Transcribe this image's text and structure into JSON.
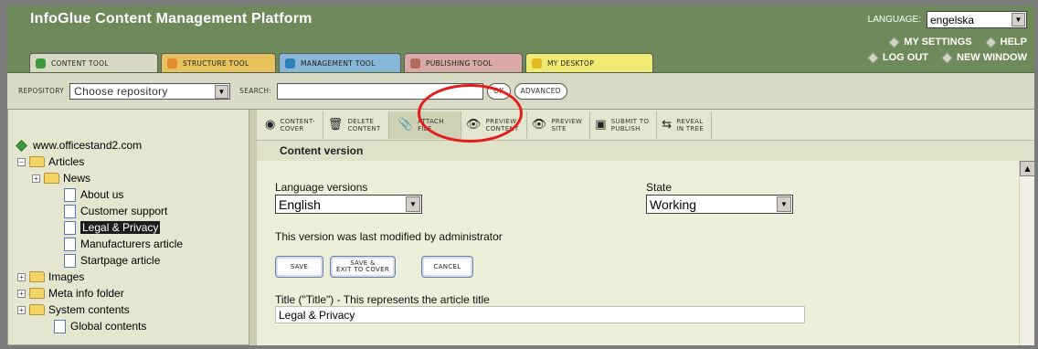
{
  "header": {
    "title": "InfoGlue Content Management Platform",
    "language_label": "LANGUAGE:",
    "language_value": "engelska",
    "links": [
      "MY SETTINGS",
      "HELP",
      "LOG OUT",
      "NEW WINDOW"
    ]
  },
  "tabs": [
    {
      "label": "CONTENT TOOL",
      "color": "#d8d9c4",
      "icon": "#3e9a3e"
    },
    {
      "label": "STRUCTURE TOOL",
      "color": "#e7c25d",
      "icon": "#e38b2e"
    },
    {
      "label": "MANAGEMENT TOOL",
      "color": "#88b6d6",
      "icon": "#2e7fb7"
    },
    {
      "label": "PUBLISHING TOOL",
      "color": "#d9a9a9",
      "icon": "#b36a5e"
    },
    {
      "label": "MY DESKTOP",
      "color": "#efea72",
      "icon": "#e0b920"
    }
  ],
  "toolbar": {
    "repository_label": "REPOSITORY",
    "repository_value": "Choose repository",
    "search_label": "SEARCH:",
    "search_value": "",
    "ok_label": "OK",
    "advanced_label": "ADVANCED"
  },
  "tree": {
    "root": "www.officestand2.com",
    "articles": "Articles",
    "news": "News",
    "about": "About us",
    "support": "Customer support",
    "legal": "Legal & Privacy",
    "manufacturers": "Manufacturers article",
    "startpage": "Startpage article",
    "images": "Images",
    "meta": "Meta info folder",
    "system": "System contents",
    "global": "Global contents"
  },
  "actions": {
    "cover": [
      "CONTENT-",
      "COVER"
    ],
    "delete": [
      "DELETE",
      "CONTENT"
    ],
    "attach": [
      "ATTACH",
      "FILE"
    ],
    "preview_content": [
      "PREVIEW",
      "CONTENT"
    ],
    "preview_site": [
      "PREVIEW",
      "SITE"
    ],
    "submit": [
      "SUBMIT TO",
      "PUBLISH"
    ],
    "reveal": [
      "REVEAL",
      "IN TREE"
    ]
  },
  "editor": {
    "section_title": "Content version",
    "language_versions_label": "Language versions",
    "language_versions_value": "English",
    "state_label": "State",
    "state_value": "Working",
    "modified_text": "This version was last modified by administrator",
    "save_label": "SAVE",
    "save_exit_label": [
      "SAVE &",
      "EXIT TO COVER"
    ],
    "cancel_label": "CANCEL",
    "title_field_label": "Title (\"Title\") - This represents the article title",
    "title_field_value": "Legal & Privacy"
  },
  "colors": {
    "header_bg": "#6f8a5a",
    "toolbar_bg": "#d9dbc6",
    "highlight_circle": "#e41c1c"
  }
}
